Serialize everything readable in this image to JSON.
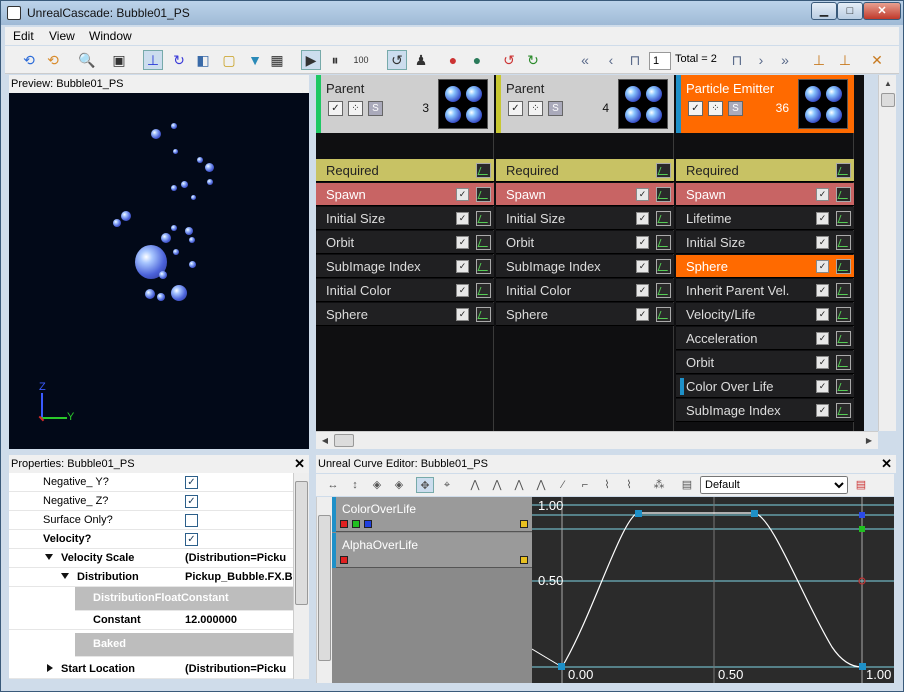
{
  "window": {
    "title": "UnrealCascade: Bubble01_PS",
    "minimize": "▁",
    "maximize": "□",
    "close": "✕"
  },
  "menu": [
    "Edit",
    "View",
    "Window"
  ],
  "toolbar": {
    "rate_label": "100",
    "lod_value": "1",
    "lod_total": "Total = 2"
  },
  "preview": {
    "header": "Preview: Bubble01_PS",
    "axis_z": "Z",
    "axis_y": "Y"
  },
  "emitters": [
    {
      "name": "Parent",
      "count": "3",
      "stripe_color": "#1ec864",
      "modules": [
        "Required",
        "Spawn",
        "Initial Size",
        "Orbit",
        "SubImage Index",
        "Initial Color",
        "Sphere"
      ]
    },
    {
      "name": "Parent",
      "count": "4",
      "stripe_color": "#c8c832",
      "modules": [
        "Required",
        "Spawn",
        "Initial Size",
        "Orbit",
        "SubImage Index",
        "Initial Color",
        "Sphere"
      ]
    },
    {
      "name": "Particle Emitter",
      "count": "36",
      "stripe_color": "#1e90c8",
      "modules": [
        "Required",
        "Spawn",
        "Lifetime",
        "Initial Size",
        "Sphere",
        "Inherit Parent Vel.",
        "Velocity/Life",
        "Acceleration",
        "Orbit",
        "Color Over Life",
        "SubImage Index"
      ]
    }
  ],
  "emitter_checkbox_labels": {
    "check": "✓",
    "solo": "S"
  },
  "properties": {
    "header": "Properties: Bubble01_PS",
    "rows": [
      {
        "label": "Negative_ Y?",
        "checked": true
      },
      {
        "label": "Negative_ Z?",
        "checked": true
      },
      {
        "label": "Surface Only?",
        "checked": false
      },
      {
        "label": "Velocity?",
        "checked": true
      },
      {
        "label": "Velocity Scale",
        "value": "(Distribution=Picku"
      },
      {
        "label": "Distribution",
        "value": "Pickup_Bubble.FX.B"
      },
      {
        "label": "DistributionFloatConstant"
      },
      {
        "label": "Constant",
        "value": "12.000000"
      },
      {
        "label": "Baked"
      },
      {
        "label": "Start Location",
        "value": "(Distribution=Picku"
      }
    ]
  },
  "curve_editor": {
    "header": "Unreal Curve Editor: Bubble01_PS",
    "preset": "Default",
    "curves": [
      {
        "name": "ColorOverLife",
        "channels": [
          "#e02020",
          "#20c020",
          "#2040e0"
        ],
        "flag_color": "#e8c020"
      },
      {
        "name": "AlphaOverLife",
        "channels": [
          "#e02020"
        ],
        "flag_color": "#e8c020"
      }
    ],
    "axis_labels": {
      "y_top": "1.00",
      "y_mid": "0.50",
      "x0": "0.00",
      "x1": "0.50",
      "x2": "1.00"
    }
  }
}
